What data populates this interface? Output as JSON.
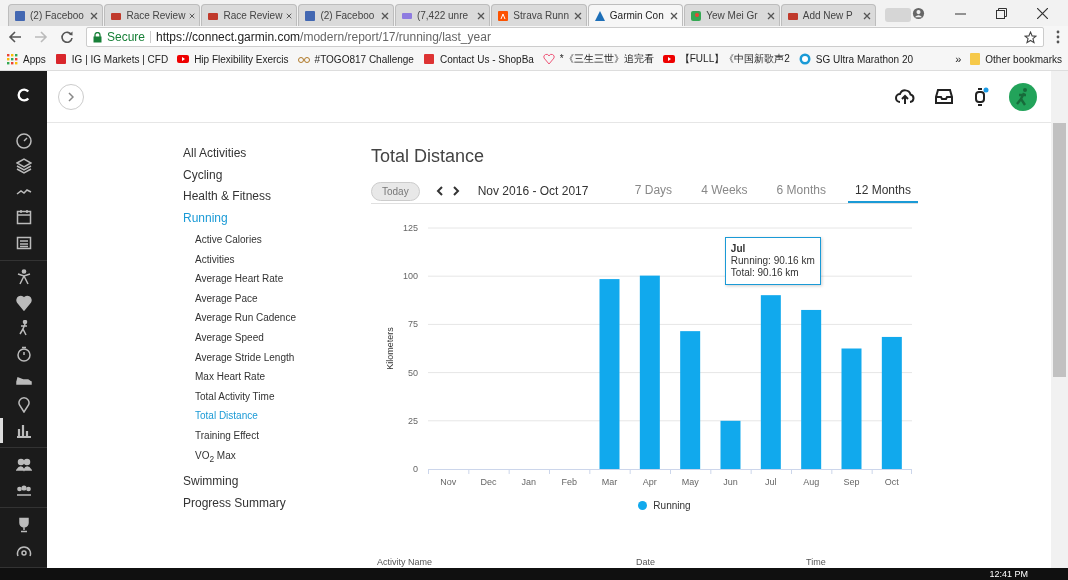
{
  "browser": {
    "tabs": [
      {
        "title": "(2) Faceboo",
        "kind": "facebook",
        "selected": false
      },
      {
        "title": "Race Review",
        "kind": "race",
        "selected": false
      },
      {
        "title": "Race Review",
        "kind": "race",
        "selected": false
      },
      {
        "title": "(2) Faceboo",
        "kind": "facebook",
        "selected": false
      },
      {
        "title": "(7,422 unre",
        "kind": "mail",
        "selected": false
      },
      {
        "title": "Strava Runn",
        "kind": "strava",
        "selected": false
      },
      {
        "title": "Garmin Con",
        "kind": "garmin",
        "selected": true
      },
      {
        "title": "Yew Mei Gr",
        "kind": "maps",
        "selected": false
      },
      {
        "title": "Add New P",
        "kind": "race",
        "selected": false
      }
    ],
    "secure_label": "Secure",
    "url_host": "https://connect.garmin.com",
    "url_path": "/modern/report/17/running/last_year",
    "bookmarks": [
      {
        "label": "Apps",
        "kind": "apps"
      },
      {
        "label": "IG | IG Markets | CFD",
        "kind": "ig"
      },
      {
        "label": "Hip Flexibility Exercis",
        "kind": "youtube"
      },
      {
        "label": "#TOGO817 Challenge",
        "kind": "bike"
      },
      {
        "label": "Contact Us - ShopBa",
        "kind": "shop"
      },
      {
        "label": "*《三生三世》追完看",
        "kind": "heart"
      },
      {
        "label": "【FULL】《中国新歌声2",
        "kind": "youtube"
      },
      {
        "label": "SG Ultra Marathon 20",
        "kind": "d"
      }
    ],
    "more": "»",
    "other_bookmarks": "Other bookmarks"
  },
  "rail": {
    "groups": [
      {
        "items": [
          {
            "kind": "gauge",
            "selected": false
          },
          {
            "kind": "layers",
            "selected": false
          },
          {
            "kind": "wave",
            "selected": false
          },
          {
            "kind": "calendar",
            "selected": false
          },
          {
            "kind": "news",
            "selected": false
          }
        ]
      },
      {
        "items": [
          {
            "kind": "figure",
            "selected": false
          },
          {
            "kind": "heart",
            "selected": false
          },
          {
            "kind": "runner",
            "selected": false
          },
          {
            "kind": "stopwatch",
            "selected": false
          },
          {
            "kind": "shoe",
            "selected": false
          },
          {
            "kind": "pin",
            "selected": false
          },
          {
            "kind": "chart",
            "selected": true
          }
        ]
      },
      {
        "items": [
          {
            "kind": "people",
            "selected": false
          },
          {
            "kind": "group",
            "selected": false
          }
        ]
      },
      {
        "items": [
          {
            "kind": "trophy",
            "selected": false
          },
          {
            "kind": "arc",
            "selected": false
          }
        ]
      }
    ]
  },
  "nav": {
    "items": [
      {
        "label": "All Activities",
        "selected": false
      },
      {
        "label": "Cycling",
        "selected": false
      },
      {
        "label": "Health & Fitness",
        "selected": false
      },
      {
        "label": "Running",
        "selected": true,
        "children": [
          {
            "label": "Active Calories",
            "selected": false
          },
          {
            "label": "Activities",
            "selected": false
          },
          {
            "label": "Average Heart Rate",
            "selected": false
          },
          {
            "label": "Average Pace",
            "selected": false
          },
          {
            "label": "Average Run Cadence",
            "selected": false
          },
          {
            "label": "Average Speed",
            "selected": false
          },
          {
            "label": "Average Stride Length",
            "selected": false
          },
          {
            "label": "Max Heart Rate",
            "selected": false
          },
          {
            "label": "Total Activity Time",
            "selected": false
          },
          {
            "label": "Total Distance",
            "selected": true
          },
          {
            "label": "Training Effect",
            "selected": false
          },
          {
            "label": "VO$_{2}$ Max",
            "selected": false
          }
        ]
      },
      {
        "label": "Swimming",
        "selected": false
      },
      {
        "label": "Progress Summary",
        "selected": false
      }
    ]
  },
  "report": {
    "title": "Total Distance",
    "today_button": "Today",
    "range": "Nov 2016 - Oct 2017",
    "periods": [
      {
        "label": "7 Days",
        "selected": false
      },
      {
        "label": "4 Weeks",
        "selected": false
      },
      {
        "label": "6 Months",
        "selected": false
      },
      {
        "label": "12 Months",
        "selected": true
      }
    ],
    "chart_data": {
      "type": "bar",
      "ylabel": "Kilometers",
      "categories": [
        "Nov",
        "Dec",
        "Jan",
        "Feb",
        "Mar",
        "Apr",
        "May",
        "Jun",
        "Jul",
        "Aug",
        "Sep",
        "Oct"
      ],
      "series": [
        {
          "name": "Running",
          "color": "#11a9ed",
          "values": [
            0,
            0,
            0,
            0,
            98.5,
            100.3,
            71.5,
            25,
            90.16,
            82.5,
            62.5,
            68.5
          ]
        }
      ],
      "ylim": [
        0,
        125
      ],
      "grid": true,
      "yticks": [
        0,
        25,
        50,
        75,
        100,
        125
      ]
    },
    "hovered": [
      false,
      false,
      false,
      false,
      false,
      false,
      false,
      false,
      true,
      false,
      false,
      false
    ],
    "tooltip": {
      "title": "Jul",
      "lines": [
        "Running: 90.16 km",
        "Total: 90.16 km"
      ]
    },
    "table_columns": [
      "Activity Name",
      "Date",
      "Time"
    ]
  },
  "taskbar": {
    "clock": "12:41 PM"
  }
}
